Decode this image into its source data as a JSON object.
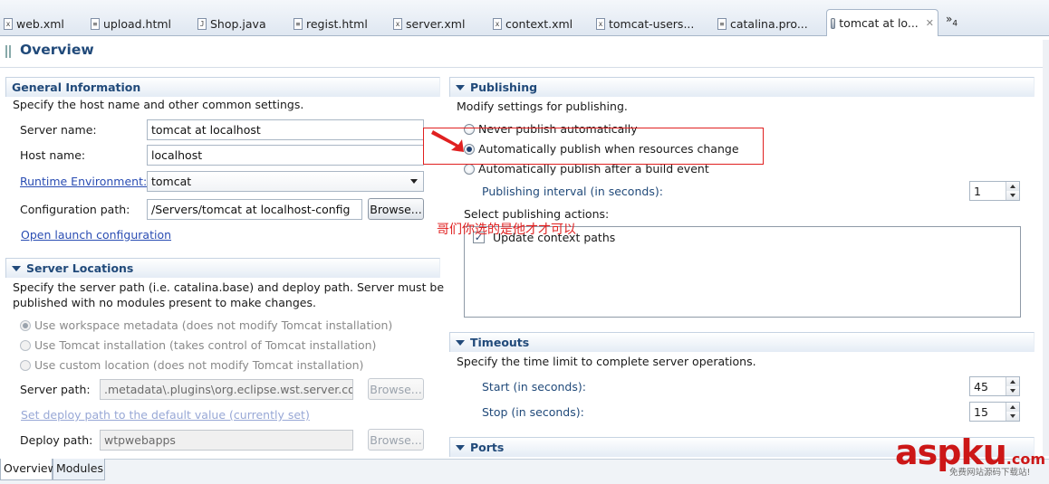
{
  "tabs": [
    {
      "label": "web.xml",
      "icon": "x"
    },
    {
      "label": "upload.html",
      "icon": "html"
    },
    {
      "label": "Shop.java",
      "icon": "J"
    },
    {
      "label": "regist.html",
      "icon": "html"
    },
    {
      "label": "server.xml",
      "icon": "x"
    },
    {
      "label": "context.xml",
      "icon": "x"
    },
    {
      "label": "tomcat-users...",
      "icon": "x"
    },
    {
      "label": "catalina.pro...",
      "icon": "file"
    },
    {
      "label": "tomcat at lo...",
      "icon": "server"
    }
  ],
  "tabs_overflow": {
    "label": "»",
    "count": "4"
  },
  "page_title": "Overview",
  "general": {
    "title": "General Information",
    "desc": "Specify the host name and other common settings.",
    "server_name_label": "Server name:",
    "server_name_value": "tomcat at localhost",
    "host_name_label": "Host name:",
    "host_name_value": "localhost",
    "runtime_label": "Runtime Environment:",
    "runtime_value": "tomcat",
    "config_label": "Configuration path:",
    "config_value": "/Servers/tomcat at localhost-config",
    "browse_label": "Browse...",
    "open_launch": "Open launch configuration"
  },
  "locations": {
    "title": "Server Locations",
    "desc_line1": "Specify the server path (i.e. catalina.base) and deploy path. Server must be",
    "desc_line2": "published with no modules present to make changes.",
    "options": [
      "Use workspace metadata (does not modify Tomcat installation)",
      "Use Tomcat installation (takes control of Tomcat installation)",
      "Use custom location (does not modify Tomcat installation)"
    ],
    "server_path_label": "Server path:",
    "server_path_value": ".metadata\\.plugins\\org.eclipse.wst.server.core\\",
    "browse_label": "Browse...",
    "set_default_link": "Set deploy path to the default value (currently set)",
    "deploy_path_label": "Deploy path:",
    "deploy_path_value": "wtpwebapps",
    "browse2_label": "Browse..."
  },
  "publishing": {
    "title": "Publishing",
    "desc": "Modify settings for publishing.",
    "options": [
      "Never publish automatically",
      "Automatically publish when resources change",
      "Automatically publish after a build event"
    ],
    "interval_label": "Publishing interval (in seconds):",
    "interval_value": "1",
    "actions_label": "Select publishing actions:",
    "action_item": "Update context paths"
  },
  "timeouts": {
    "title": "Timeouts",
    "desc": "Specify the time limit to complete server operations.",
    "start_label": "Start (in seconds):",
    "start_value": "45",
    "stop_label": "Stop (in seconds):",
    "stop_value": "15"
  },
  "ports": {
    "title": "Ports"
  },
  "bottom_tabs": [
    "Overview",
    "Modules"
  ],
  "annotation_text": "哥们你选的是他才才可以",
  "watermark": {
    "main": "aspku",
    "suffix": ".com",
    "sub": "免费网站源码下载站!"
  },
  "colors": {
    "accent": "#214a7a",
    "annotation": "#e02020",
    "link": "#2a4db3"
  }
}
